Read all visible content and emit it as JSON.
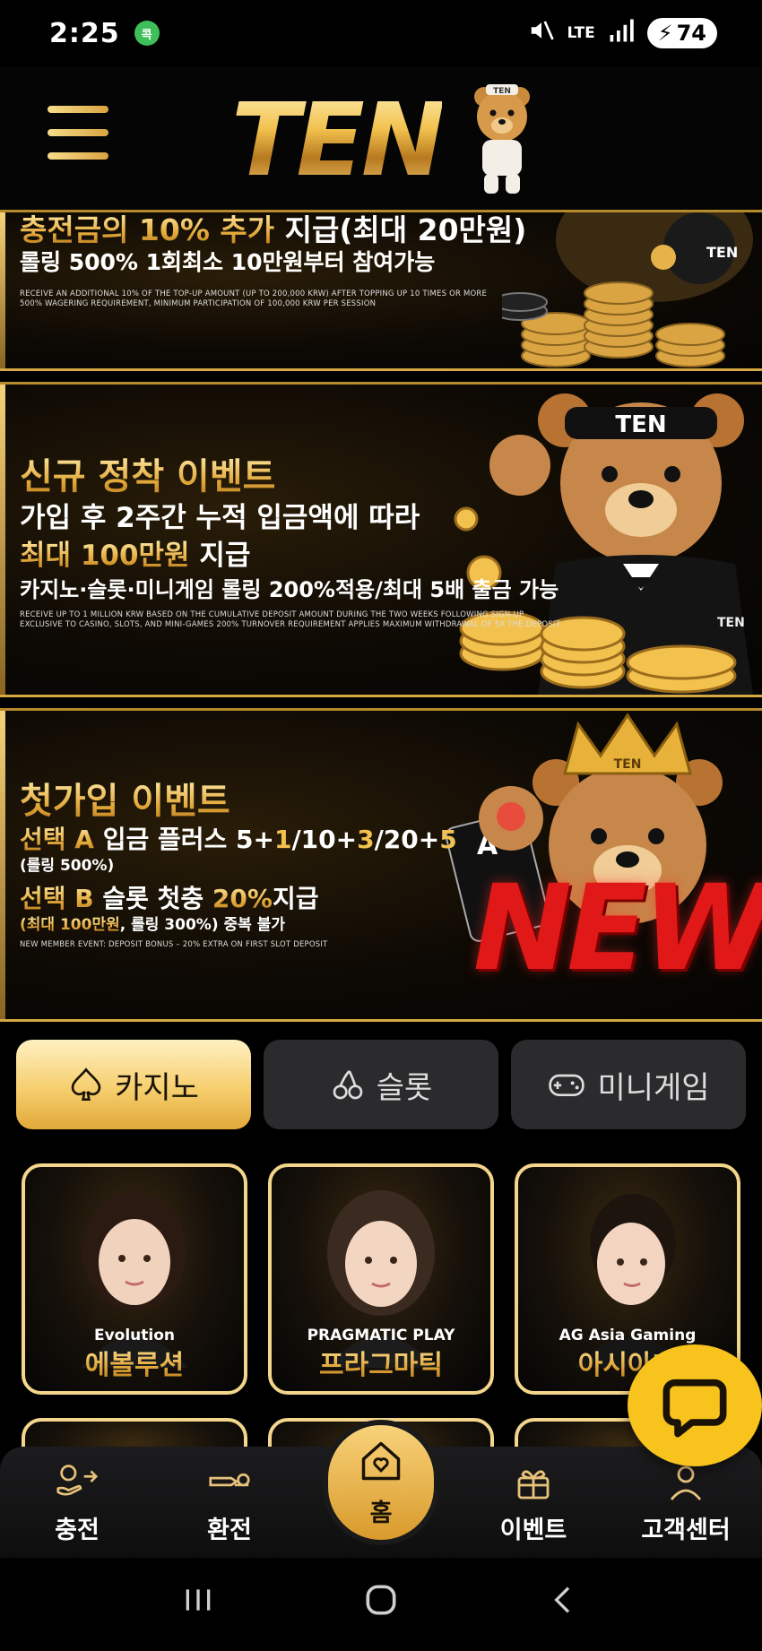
{
  "status_bar": {
    "time": "2:25",
    "app_badge": "콕",
    "network": "LTE",
    "battery": "74"
  },
  "header": {
    "logo_text": "TEN",
    "logo_bear_label": "TEN"
  },
  "banners": [
    {
      "headline_part1": "충전금의 10% 추가",
      "headline_part2": " 지급(최대 20만원)",
      "subline": "롤링 500% 1회최소 10만원부터 참여가능",
      "fine_line1": "RECEIVE AN ADDITIONAL 10% OF THE TOP-UP AMOUNT (UP TO 200,000 KRW) AFTER TOPPING UP 10 TIMES OR MORE",
      "fine_line2": "500% WAGERING REQUIREMENT, MINIMUM PARTICIPATION OF 100,000 KRW PER SESSION",
      "art_label": "TEN"
    },
    {
      "headline": "신규 정착 이벤트",
      "line1": "가입 후 2주간 누적 입금액에 따라",
      "line2_gold": "최대 100만원",
      "line2_white": " 지급",
      "line3": "카지노·슬롯·미니게임 롤링 200%적용/최대 5배 출금 가능",
      "fine_line1": "RECEIVE UP TO 1 MILLION KRW BASED ON THE CUMULATIVE DEPOSIT AMOUNT DURING THE TWO WEEKS FOLLOWING SIGN-UP",
      "fine_line2": "EXCLUSIVE TO CASINO, SLOTS, AND MINI-GAMES 200% TURNOVER REQUIREMENT APPLIES MAXIMUM WITHDRAWAL OF 5X THE DEPOSIT",
      "headband_label": "TEN",
      "badge_label": "TEN"
    },
    {
      "headline": "첫가입 이벤트",
      "option_a_gold": "선택 A",
      "option_a_white": " 입금 플러스 5+",
      "option_a_rest1": "1",
      "option_a_rest2": "/10+",
      "option_a_rest3": "3",
      "option_a_rest4": "/20+",
      "option_a_rest5": "5",
      "option_a_note": "(롤링 500%)",
      "option_b_gold": "선택 B",
      "option_b_white": " 슬롯 첫충 ",
      "option_b_gold2": "20%",
      "option_b_white2": "지급",
      "option_b_note_gold": "(최대 100만원",
      "option_b_note_white": ", 롤링 300%) 중복 불가",
      "fine_line": "NEW MEMBER EVENT: DEPOSIT BONUS – 20% EXTRA ON FIRST SLOT DEPOSIT",
      "new_badge": "NEW",
      "card_letter": "A",
      "crown_label": "TEN"
    }
  ],
  "tabs": [
    {
      "label": "카지노",
      "icon": "spade-icon",
      "active": true
    },
    {
      "label": "슬롯",
      "icon": "cherry-icon",
      "active": false
    },
    {
      "label": "미니게임",
      "icon": "gamepad-icon",
      "active": false
    }
  ],
  "games": [
    {
      "provider_logo": "Evolution",
      "name": "에볼루션"
    },
    {
      "provider_logo": "PRAGMATIC PLAY",
      "name": "프라그마틱"
    },
    {
      "provider_logo": "AG Asia Gaming",
      "name": "아시아게"
    }
  ],
  "bottom_nav": {
    "charge": "충전",
    "exchange": "환전",
    "home": "홈",
    "events": "이벤트",
    "support": "고객센터"
  },
  "colors": {
    "gold": "#f2c14e",
    "chat_yellow": "#f7c31c",
    "new_red": "#e01818"
  }
}
